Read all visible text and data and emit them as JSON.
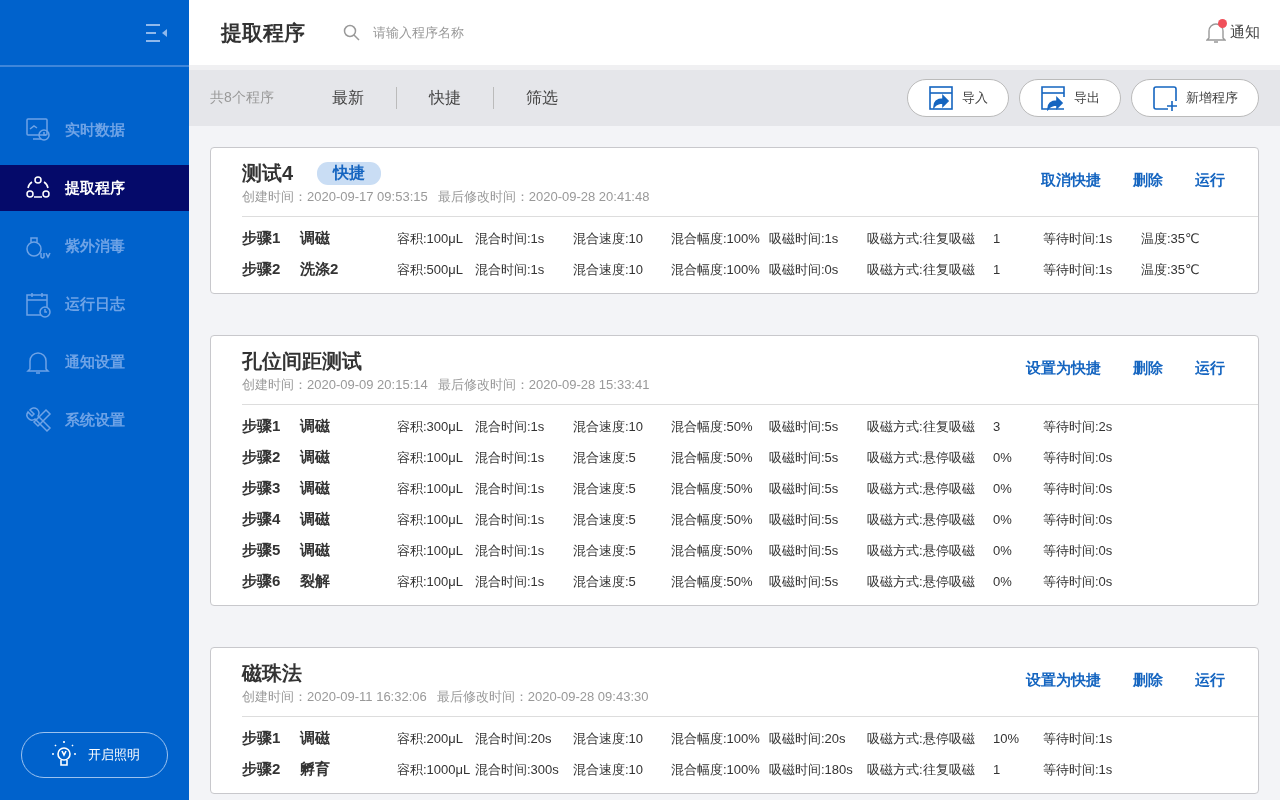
{
  "sidebar": {
    "items": [
      {
        "label": "实时数据",
        "kind": "monitor",
        "selected": false
      },
      {
        "label": "提取程序",
        "kind": "nodes",
        "selected": true
      },
      {
        "label": "紫外消毒",
        "kind": "uv",
        "selected": false
      },
      {
        "label": "运行日志",
        "kind": "calendar",
        "selected": false
      },
      {
        "label": "通知设置",
        "kind": "bell",
        "selected": false
      },
      {
        "label": "系统设置",
        "kind": "tools",
        "selected": false
      }
    ],
    "light_button": "开启照明"
  },
  "header": {
    "title": "提取程序",
    "search": {
      "placeholder": "请输入程序名称"
    },
    "notification": {
      "label": "通知",
      "unread": true
    }
  },
  "toolbar": {
    "count": "共8个程序",
    "filters": [
      "最新",
      "快捷",
      "筛选"
    ],
    "buttons": [
      {
        "label": "导入",
        "kind": "import"
      },
      {
        "label": "导出",
        "kind": "export"
      },
      {
        "label": "新增程序",
        "kind": "add"
      }
    ]
  },
  "programs": [
    {
      "name": "测试4",
      "tag": "快捷",
      "created": "创建时间：2020-09-17 09:53:15",
      "modified": "最后修改时间：2020-09-28 20:41:48",
      "actions": [
        "取消快捷",
        "删除",
        "运行"
      ],
      "steps": [
        [
          "步骤1",
          "调磁",
          "容积:100μL",
          "混合时间:1s",
          "混合速度:10",
          "混合幅度:100%",
          "吸磁时间:1s",
          "吸磁方式:往复吸磁",
          "1",
          "等待时间:1s",
          "温度:35℃"
        ],
        [
          "步骤2",
          "洗涤2",
          "容积:500μL",
          "混合时间:1s",
          "混合速度:10",
          "混合幅度:100%",
          "吸磁时间:0s",
          "吸磁方式:往复吸磁",
          "1",
          "等待时间:1s",
          "温度:35℃"
        ]
      ]
    },
    {
      "name": "孔位间距测试",
      "created": "创建时间：2020-09-09 20:15:14",
      "modified": "最后修改时间：2020-09-28 15:33:41",
      "actions": [
        "设置为快捷",
        "删除",
        "运行"
      ],
      "steps": [
        [
          "步骤1",
          "调磁",
          "容积:300μL",
          "混合时间:1s",
          "混合速度:10",
          "混合幅度:50%",
          "吸磁时间:5s",
          "吸磁方式:往复吸磁",
          "3",
          "等待时间:2s"
        ],
        [
          "步骤2",
          "调磁",
          "容积:100μL",
          "混合时间:1s",
          "混合速度:5",
          "混合幅度:50%",
          "吸磁时间:5s",
          "吸磁方式:悬停吸磁",
          "0%",
          "等待时间:0s"
        ],
        [
          "步骤3",
          "调磁",
          "容积:100μL",
          "混合时间:1s",
          "混合速度:5",
          "混合幅度:50%",
          "吸磁时间:5s",
          "吸磁方式:悬停吸磁",
          "0%",
          "等待时间:0s"
        ],
        [
          "步骤4",
          "调磁",
          "容积:100μL",
          "混合时间:1s",
          "混合速度:5",
          "混合幅度:50%",
          "吸磁时间:5s",
          "吸磁方式:悬停吸磁",
          "0%",
          "等待时间:0s"
        ],
        [
          "步骤5",
          "调磁",
          "容积:100μL",
          "混合时间:1s",
          "混合速度:5",
          "混合幅度:50%",
          "吸磁时间:5s",
          "吸磁方式:悬停吸磁",
          "0%",
          "等待时间:0s"
        ],
        [
          "步骤6",
          "裂解",
          "容积:100μL",
          "混合时间:1s",
          "混合速度:5",
          "混合幅度:50%",
          "吸磁时间:5s",
          "吸磁方式:悬停吸磁",
          "0%",
          "等待时间:0s"
        ]
      ]
    },
    {
      "name": "磁珠法",
      "created": "创建时间：2020-09-11 16:32:06",
      "modified": "最后修改时间：2020-09-28 09:43:30",
      "actions": [
        "设置为快捷",
        "删除",
        "运行"
      ],
      "steps": [
        [
          "步骤1",
          "调磁",
          "容积:200μL",
          "混合时间:20s",
          "混合速度:10",
          "混合幅度:100%",
          "吸磁时间:20s",
          "吸磁方式:悬停吸磁",
          "10%",
          "等待时间:1s"
        ],
        [
          "步骤2",
          "孵育",
          "容积:1000μL",
          "混合时间:300s",
          "混合速度:10",
          "混合幅度:100%",
          "吸磁时间:180s",
          "吸磁方式:往复吸磁",
          "1",
          "等待时间:1s"
        ]
      ]
    }
  ]
}
